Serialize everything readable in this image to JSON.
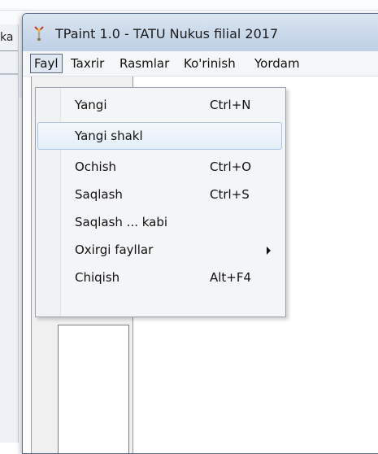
{
  "background": {
    "fragment_text": "ka"
  },
  "window": {
    "title": "TPaint 1.0 - TATU Nukus filial 2017",
    "icon": "tpaint-app-icon"
  },
  "menubar": {
    "items": [
      {
        "label": "Fayl",
        "active": true
      },
      {
        "label": "Taxrir"
      },
      {
        "label": "Rasmlar"
      },
      {
        "label": "Ko'rinish"
      },
      {
        "label": "Yordam"
      }
    ]
  },
  "file_menu": {
    "items": [
      {
        "label": "Yangi",
        "shortcut": "Ctrl+N"
      },
      {
        "label": "Yangi shakl",
        "shortcut": "",
        "highlighted": true
      },
      {
        "label": "Ochish",
        "shortcut": "Ctrl+O"
      },
      {
        "label": "Saqlash",
        "shortcut": "Ctrl+S"
      },
      {
        "label": "Saqlash ... kabi",
        "shortcut": ""
      },
      {
        "label": "Oxirgi fayllar",
        "shortcut": "",
        "submenu": true,
        "submenu_icon": "chevron-right-icon"
      },
      {
        "label": "Chiqish",
        "shortcut": "Alt+F4"
      }
    ]
  },
  "colors": {
    "titlebar": "#c9d8ea",
    "menu_highlight_border": "#a9c4e2",
    "menu_background": "#f4f5f7"
  }
}
